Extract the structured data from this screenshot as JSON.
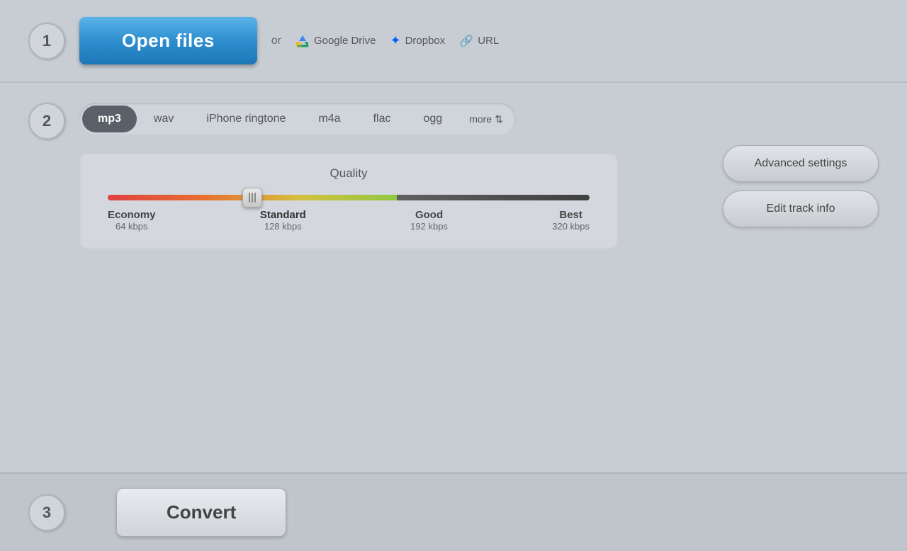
{
  "steps": {
    "step1": {
      "number": "1",
      "open_files_label": "Open files",
      "or_label": "or",
      "google_drive_label": "Google Drive",
      "dropbox_label": "Dropbox",
      "url_label": "URL"
    },
    "step2": {
      "number": "2",
      "format_tabs": [
        {
          "id": "mp3",
          "label": "mp3",
          "active": true
        },
        {
          "id": "wav",
          "label": "wav",
          "active": false
        },
        {
          "id": "iphone-ringtone",
          "label": "iPhone ringtone",
          "active": false
        },
        {
          "id": "m4a",
          "label": "m4a",
          "active": false
        },
        {
          "id": "flac",
          "label": "flac",
          "active": false
        },
        {
          "id": "ogg",
          "label": "ogg",
          "active": false
        }
      ],
      "more_label": "more",
      "quality": {
        "label": "Quality",
        "markers": [
          {
            "name": "Economy",
            "kbps": "64 kbps"
          },
          {
            "name": "Standard",
            "kbps": "128 kbps"
          },
          {
            "name": "Good",
            "kbps": "192 kbps"
          },
          {
            "name": "Best",
            "kbps": "320 kbps"
          }
        ],
        "active_marker": "Standard"
      },
      "advanced_settings_label": "Advanced settings",
      "edit_track_info_label": "Edit track info"
    },
    "step3": {
      "number": "3",
      "convert_label": "Convert"
    }
  }
}
